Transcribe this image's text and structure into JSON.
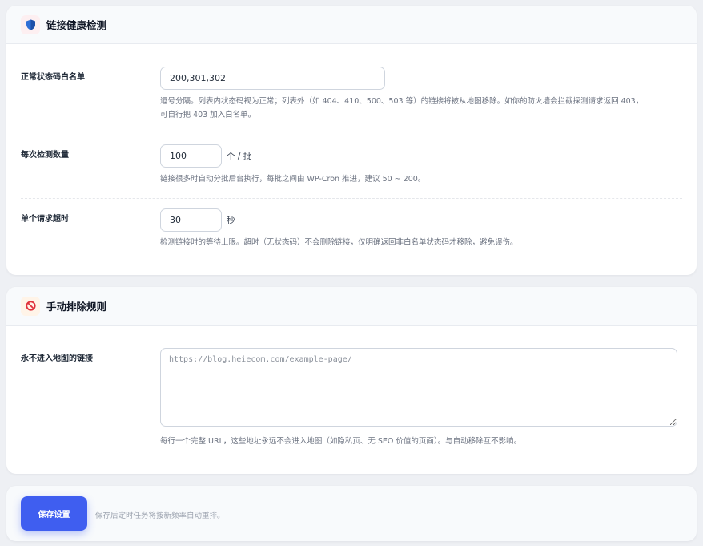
{
  "health": {
    "title": "链接健康检测",
    "icon": "shield-icon",
    "whitelist": {
      "label": "正常状态码白名单",
      "value": "200,301,302",
      "help1": "逗号分隔。列表内状态码视为正常；列表外（如 404、410、500、503 等）的链接将被从地图移除。如你的防火墙会拦截探测请求返回 403，",
      "help2": "可自行把 403 加入白名单。"
    },
    "batch": {
      "label": "每次检测数量",
      "value": "100",
      "unit": "个 / 批",
      "help": "链接很多时自动分批后台执行，每批之间由 WP-Cron 推进，建议 50 ~ 200。"
    },
    "timeout": {
      "label": "单个请求超时",
      "value": "30",
      "unit": "秒",
      "help": "检测链接时的等待上限。超时（无状态码）不会删除链接，仅明确返回非白名单状态码才移除，避免误伤。"
    }
  },
  "exclude": {
    "title": "手动排除规则",
    "icon": "no-entry-icon",
    "label": "永不进入地图的链接",
    "placeholder": "https://blog.heiecom.com/example-page/",
    "help": "每行一个完整 URL，这些地址永远不会进入地图（如隐私页、无 SEO 价值的页面）。与自动移除互不影响。"
  },
  "footer": {
    "save_label": "保存设置",
    "note": "保存后定时任务将按新频率自动重排。"
  },
  "colors": {
    "accent": "#3f5ef0",
    "page_bg": "#eef0f4",
    "header_bg": "#f8fafc"
  }
}
